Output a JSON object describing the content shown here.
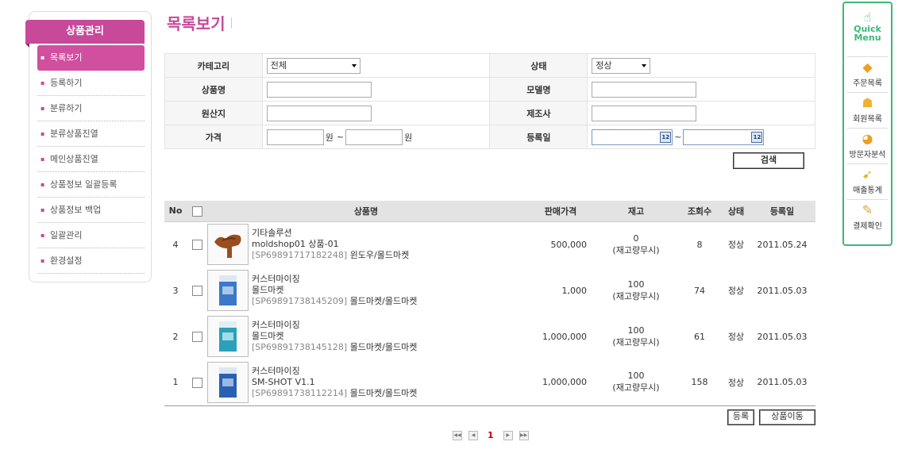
{
  "sidebar": {
    "title": "상품관리",
    "items": [
      {
        "label": "목록보기",
        "active": true
      },
      {
        "label": "등록하기"
      },
      {
        "label": "분류하기"
      },
      {
        "label": "분류상품진열"
      },
      {
        "label": "메인상품진열"
      },
      {
        "label": "상품정보 일괄등록"
      },
      {
        "label": "상품정보 백업"
      },
      {
        "label": "일괄관리"
      },
      {
        "label": "환경설정"
      }
    ]
  },
  "page": {
    "title": "목록보기"
  },
  "search": {
    "category_label": "카테고리",
    "category_value": "전체",
    "status_label": "상태",
    "status_value": "정상",
    "name_label": "상품명",
    "model_label": "모델명",
    "origin_label": "원산지",
    "maker_label": "제조사",
    "price_label": "가격",
    "price_unit": "원",
    "range_sep": "~",
    "date_label": "등록일",
    "cal_text": "12",
    "button_label": "검색"
  },
  "list": {
    "headers": {
      "no": "No",
      "name": "상품명",
      "price": "판매가격",
      "stock": "재고",
      "views": "조회수",
      "status": "상태",
      "date": "등록일"
    },
    "rows": [
      {
        "no": "4",
        "l1": "기타솔루션",
        "l2": "moldshop01 상품-01",
        "code": "[SP69891717182248]",
        "cat": "윈도우/몰드마켓",
        "price": "500,000",
        "stock": "0",
        "stock_note": "(재고량무시)",
        "views": "8",
        "status": "정상",
        "date": "2011.05.24"
      },
      {
        "no": "3",
        "l1": "커스터마이징",
        "l2": "몰드마켓",
        "code": "[SP69891738145209]",
        "cat": "몰드마켓/몰드마켓",
        "price": "1,000",
        "stock": "100",
        "stock_note": "(재고량무시)",
        "views": "74",
        "status": "정상",
        "date": "2011.05.03"
      },
      {
        "no": "2",
        "l1": "커스터마이징",
        "l2": "몰드마켓",
        "code": "[SP69891738145128]",
        "cat": "몰드마켓/몰드마켓",
        "price": "1,000,000",
        "stock": "100",
        "stock_note": "(재고량무시)",
        "views": "61",
        "status": "정상",
        "date": "2011.05.03"
      },
      {
        "no": "1",
        "l1": "커스터마이징",
        "l2": "SM-SHOT V1.1",
        "code": "[SP69891738112214]",
        "cat": "몰드마켓/몰드마켓",
        "price": "1,000,000",
        "stock": "100",
        "stock_note": "(재고량무시)",
        "views": "158",
        "status": "정상",
        "date": "2011.05.03"
      }
    ],
    "register_label": "등록",
    "move_label": "상품이동"
  },
  "pager": {
    "current": "1"
  },
  "quick": {
    "title1": "Quick",
    "title2": "Menu",
    "items": [
      {
        "label": "주문목록",
        "icon": "order-icon"
      },
      {
        "label": "회원목록",
        "icon": "member-icon"
      },
      {
        "label": "방문자분석",
        "icon": "visitor-icon"
      },
      {
        "label": "매출통계",
        "icon": "sales-icon"
      },
      {
        "label": "결제확인",
        "icon": "payment-icon"
      }
    ]
  },
  "colors": {
    "accent": "#c8489a",
    "quick": "#3cb878",
    "price": "#aa0000"
  }
}
